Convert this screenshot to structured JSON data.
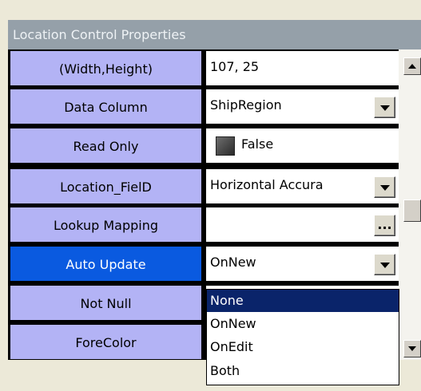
{
  "panel": {
    "title": "Location Control Properties"
  },
  "rows": [
    {
      "label": "(Width,Height)",
      "value": "107, 25"
    },
    {
      "label": "Data Column",
      "value": "ShipRegion"
    },
    {
      "label": "Read Only",
      "value": "False"
    },
    {
      "label": "Location_FielD",
      "value": "Horizontal Accura"
    },
    {
      "label": "Lookup Mapping",
      "value": "",
      "button": "..."
    },
    {
      "label": "Auto Update",
      "value": "OnNew"
    },
    {
      "label": "Not Null",
      "value": ""
    },
    {
      "label": "ForeColor",
      "value": ""
    }
  ],
  "dropdown": {
    "options": [
      "None",
      "OnNew",
      "OnEdit",
      "Both"
    ],
    "highlighted": "None"
  },
  "colors": {
    "label_bg": "#b3b3f5",
    "selected_bg": "#0a5ae0",
    "title_bg": "#95a0a9",
    "highlight": "#0a246a"
  }
}
